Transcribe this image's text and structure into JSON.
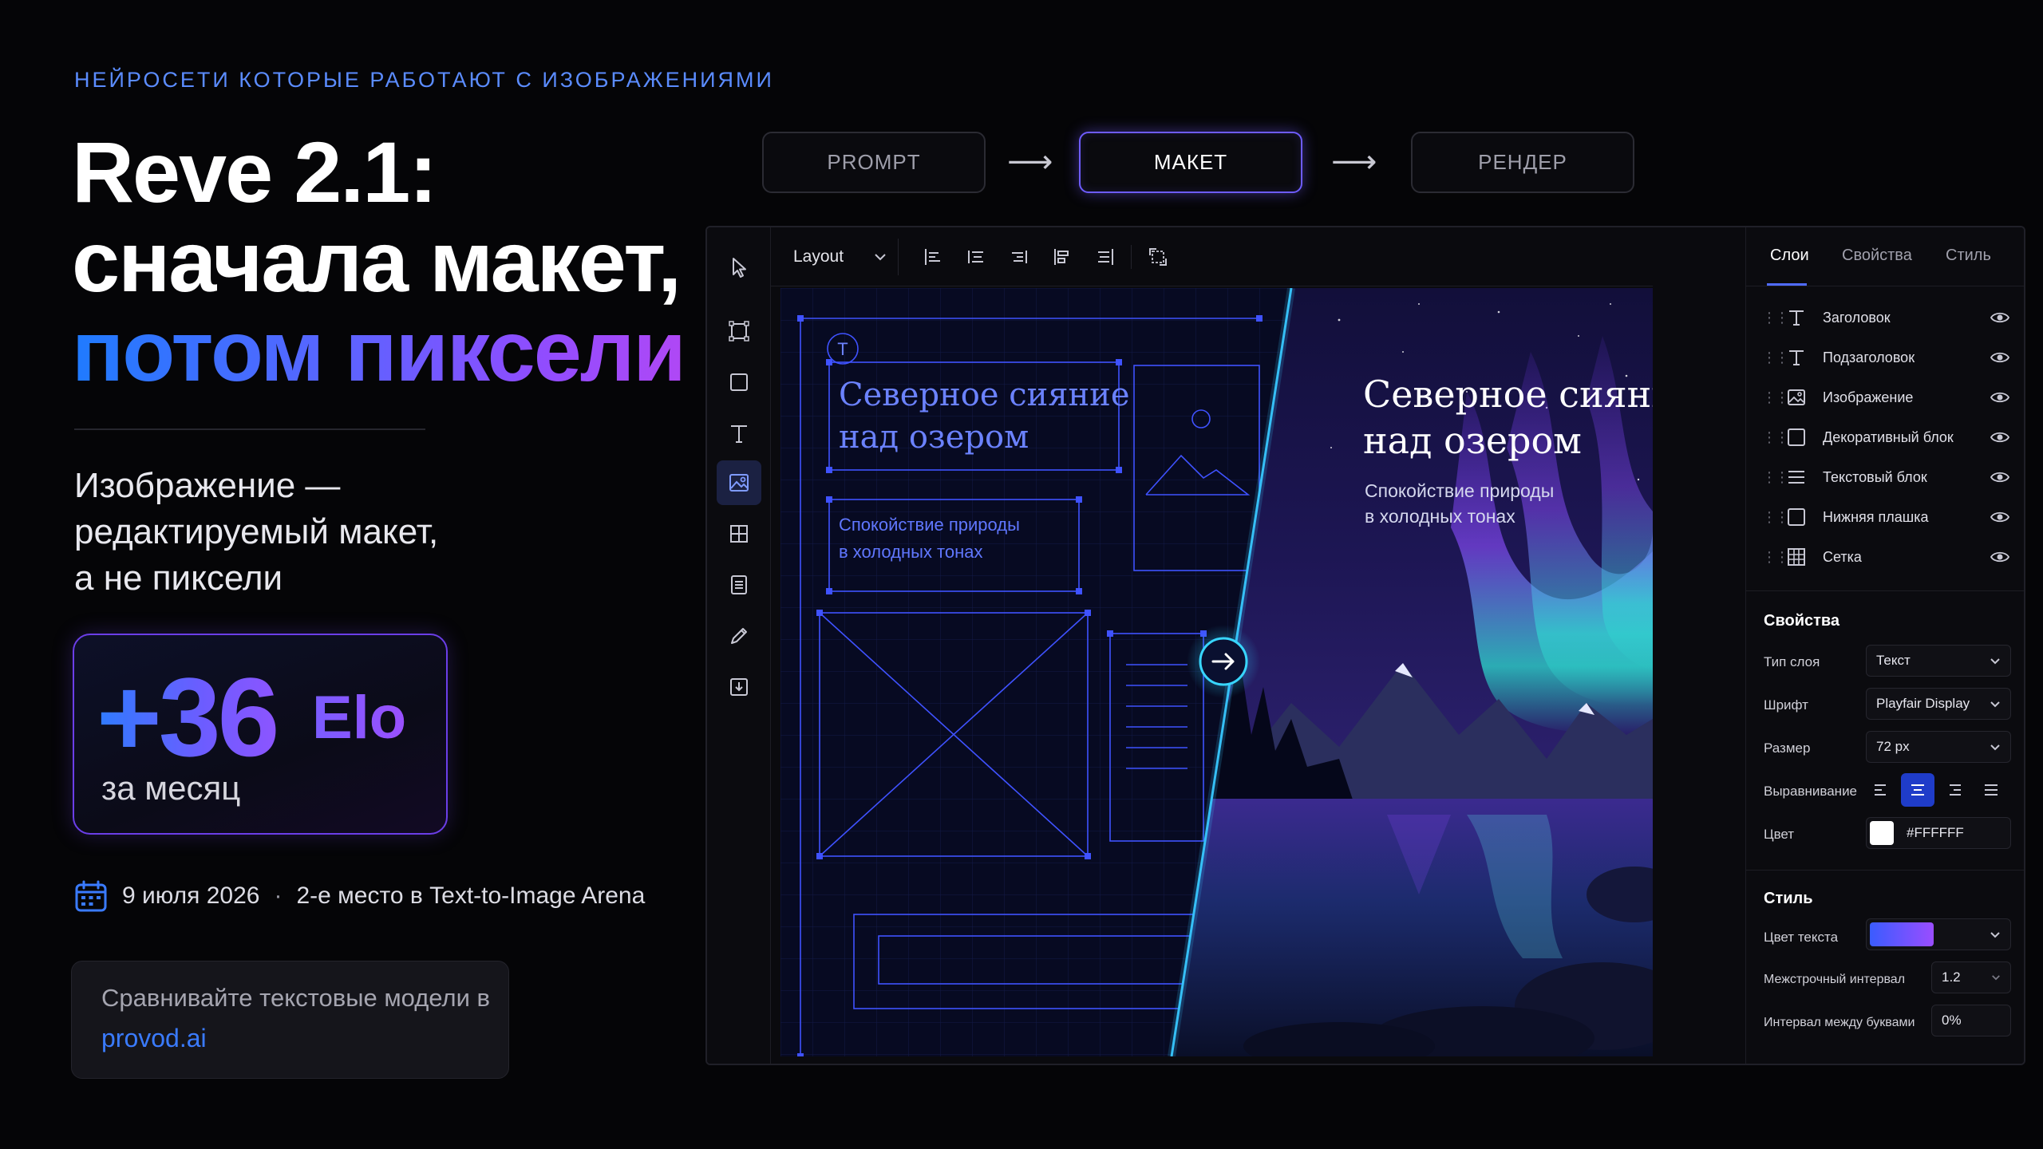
{
  "kicker": "НЕЙРОСЕТИ КОТОРЫЕ РАБОТАЮТ С ИЗОБРАЖЕНИЯМИ",
  "headline": {
    "line1": "Reve 2.1:",
    "line2": "сначала макет,",
    "line3": "потом пиксели"
  },
  "subtitle": {
    "line1": "Изображение —",
    "line2": "редактируемый макет,",
    "line3": "а не пиксели"
  },
  "elo": {
    "value": "+36",
    "unit": "Elo",
    "period": "за месяц"
  },
  "meta": {
    "date": "9 июля 2026",
    "separator": "·",
    "rank": "2-е место в Text-to-Image Arena"
  },
  "cta": {
    "text": "Сравнивайте текстовые модели в",
    "link": "provod.ai"
  },
  "pipeline": {
    "steps": [
      "PROMPT",
      "МАКЕТ",
      "РЕНДЕР"
    ],
    "arrow": "⟶",
    "active_index": 1
  },
  "toolbar": {
    "layout_label": "Layout"
  },
  "canvas": {
    "title_line1": "Северное сияние",
    "title_line2": "над озером",
    "sub_line1": "Спокойствие природы",
    "sub_line2": "в холодных тонах"
  },
  "panel": {
    "tabs": [
      "Слои",
      "Свойства",
      "Стиль"
    ],
    "active_tab": 0,
    "layers": [
      {
        "name": "Заголовок",
        "icon": "text-icon"
      },
      {
        "name": "Подзаголовок",
        "icon": "text-icon"
      },
      {
        "name": "Изображение",
        "icon": "image-icon"
      },
      {
        "name": "Декоративный блок",
        "icon": "square-icon"
      },
      {
        "name": "Текстовый блок",
        "icon": "lines-icon"
      },
      {
        "name": "Нижняя плашка",
        "icon": "square-icon"
      },
      {
        "name": "Сетка",
        "icon": "grid-icon"
      }
    ],
    "properties": {
      "title": "Свойства",
      "layer_type_label": "Тип слоя",
      "layer_type_value": "Текст",
      "font_label": "Шрифт",
      "font_value": "Playfair Display",
      "size_label": "Размер",
      "size_value": "72 px",
      "align_label": "Выравнивание",
      "align_active_index": 1,
      "color_label": "Цвет",
      "color_value": "#FFFFFF"
    },
    "style": {
      "title": "Стиль",
      "text_color_label": "Цвет текста",
      "line_height_label": "Межстрочный интервал",
      "line_height_value": "1.2",
      "letter_spacing_label": "Интервал между буквами",
      "letter_spacing_value": "0%"
    }
  },
  "colors": {
    "accent_blue": "#3a7bff",
    "accent_purple": "#8c55ff",
    "wire": "#4a5cff",
    "background": "#050507"
  }
}
